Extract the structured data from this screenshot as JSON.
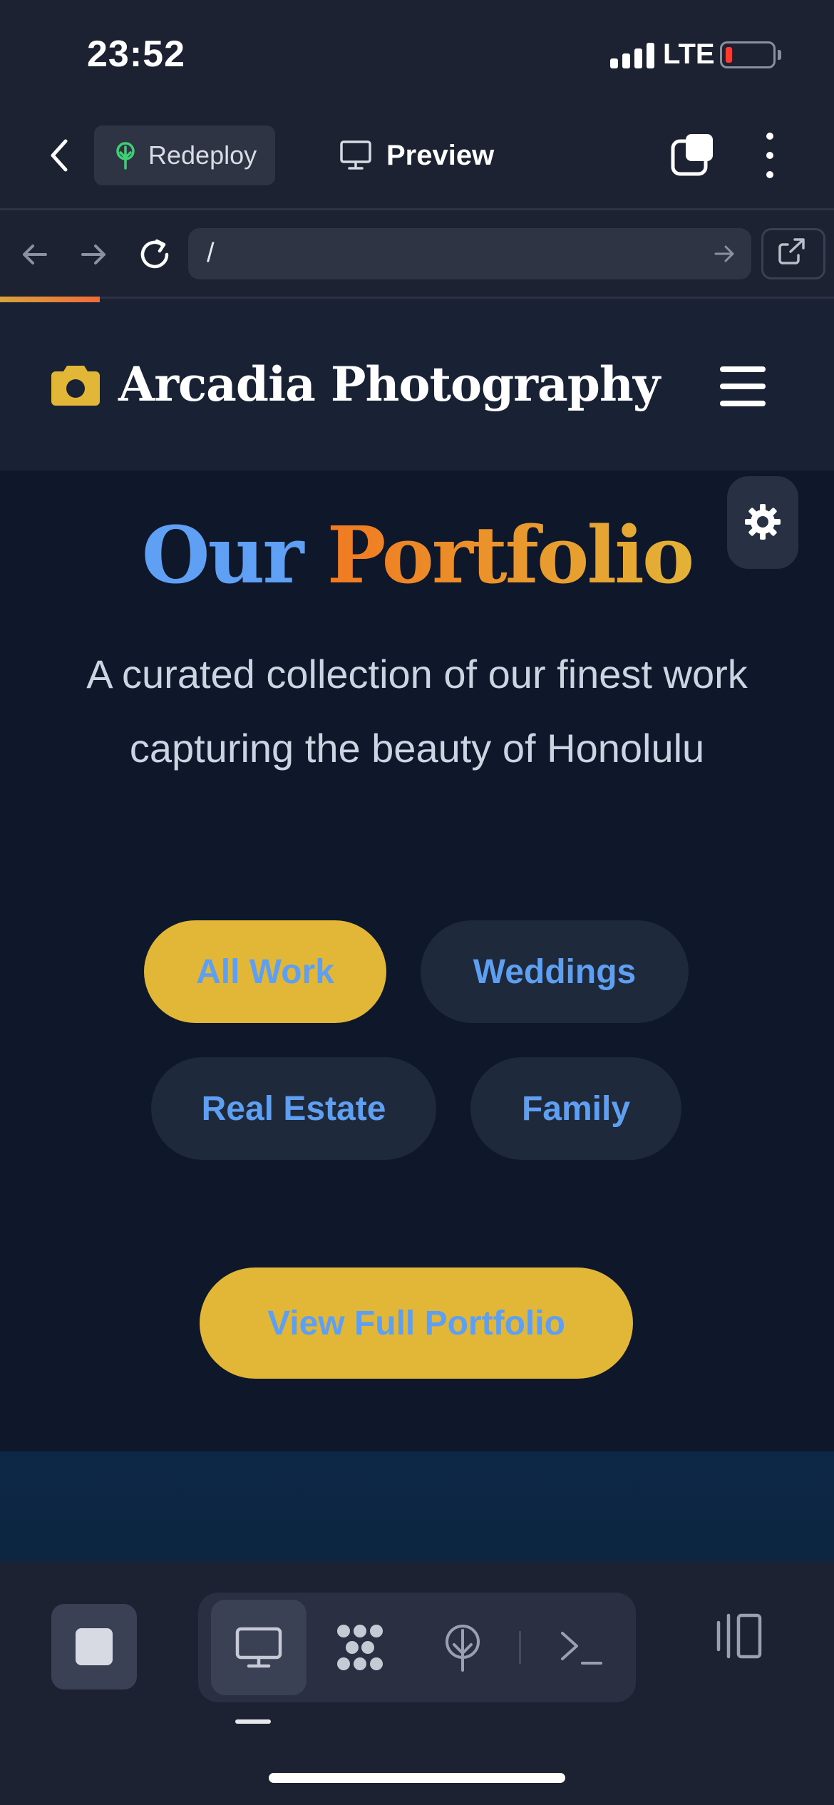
{
  "status_bar": {
    "time": "23:52",
    "network": "LTE",
    "icons": [
      "signal-icon",
      "battery-low-icon"
    ]
  },
  "toolbar": {
    "back_icon": "chevron-left-icon",
    "redeploy_label": "Redeploy",
    "redeploy_icon": "deploy-tree-icon",
    "preview_label": "Preview",
    "preview_icon": "monitor-icon",
    "tabs_icon": "tabs-icon",
    "more_icon": "more-vertical-icon"
  },
  "browser": {
    "url": "/",
    "load_progress": 0.12,
    "icons": [
      "arrow-left-icon",
      "arrow-right-icon",
      "reload-icon",
      "go-arrow-icon",
      "external-link-icon"
    ]
  },
  "site": {
    "brand_name": "Arcadia Photography",
    "brand_icon": "camera-icon",
    "menu_icon": "hamburger-icon",
    "settings_icon": "gear-icon",
    "hero_title_part1": "Our",
    "hero_title_part2": "Portfolio",
    "hero_subtitle": "A curated collection of our finest work capturing the beauty of Honolulu",
    "filters": [
      {
        "label": "All Work",
        "active": true
      },
      {
        "label": "Weddings",
        "active": false
      },
      {
        "label": "Real Estate",
        "active": false
      },
      {
        "label": "Family",
        "active": false
      }
    ],
    "cta_label": "View Full Portfolio"
  },
  "bottom_bar": {
    "tools": [
      "stop-icon",
      "monitor-icon",
      "workflow-icon",
      "deploy-icon",
      "terminal-icon",
      "panel-toggle-icon"
    ],
    "active_tool": "monitor-icon"
  },
  "colors": {
    "accent_yellow": "#e2b737",
    "accent_blue": "#5f9ff2",
    "accent_orange": "#f07a22",
    "page_bg": "#0f172a",
    "chrome_bg": "#1d2232"
  }
}
